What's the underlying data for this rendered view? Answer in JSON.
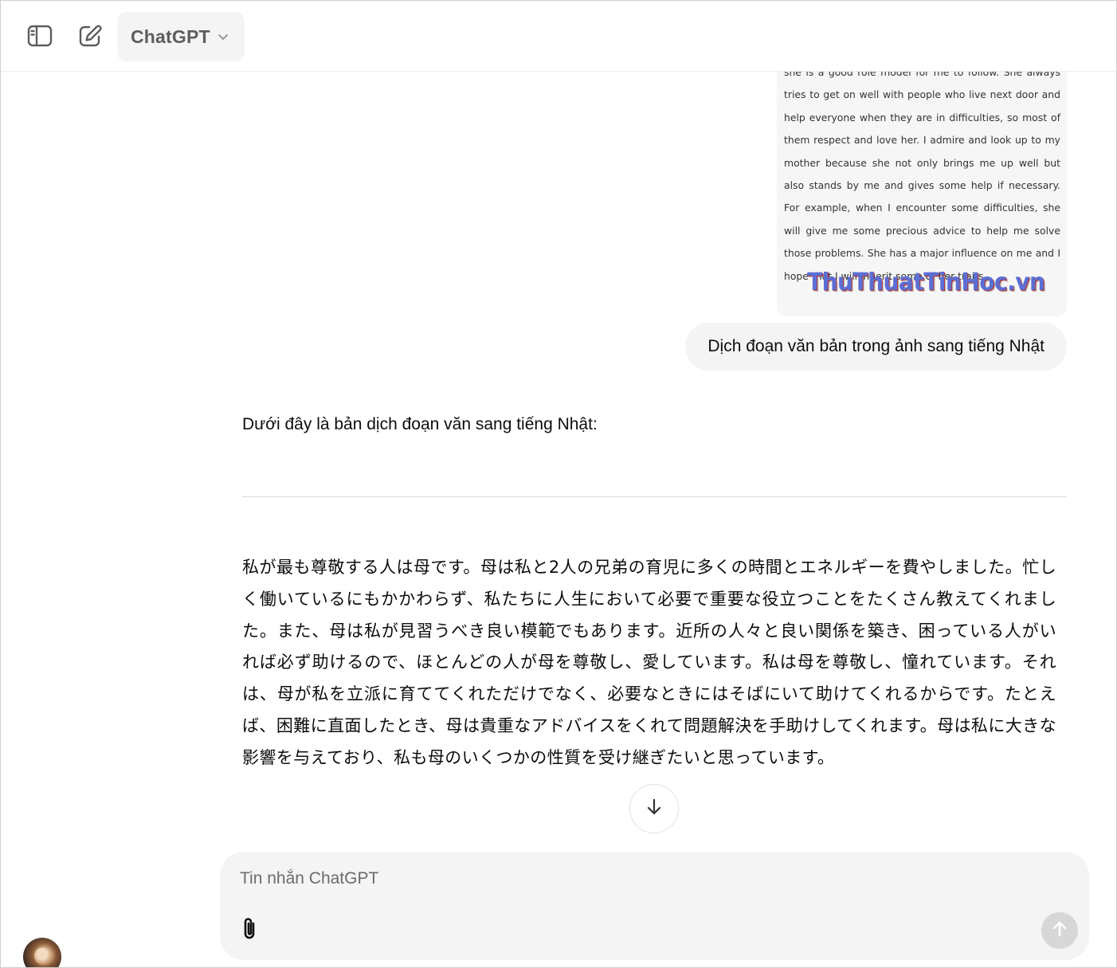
{
  "header": {
    "model_name": "ChatGPT",
    "icons": {
      "sidebar_toggle": "sidebar-toggle-icon",
      "new_chat": "new-chat-icon",
      "model_chevron": "chevron-down-icon"
    }
  },
  "conversation": {
    "attached_image": {
      "text": "she is a good role model for me to follow. She always tries to get on well with people who live next door and help everyone when they are in difficulties, so most of them respect and love her. I admire and look up to my mother because she not only brings me up well but also stands by me and gives some help if necessary. For example, when I encounter some difficulties, she will give me some precious advice to help me solve those problems. She has a major influence on me and I hope that I will inherit some of her traits.",
      "watermark": "ThuThuatTinHoc.vn"
    },
    "user_message": "Dịch đoạn văn bản trong ảnh sang tiếng Nhật",
    "assistant": {
      "intro": "Dưới đây là bản dịch đoạn văn sang tiếng Nhật:",
      "body": "私が最も尊敬する人は母です。母は私と2人の兄弟の育児に多くの時間とエネルギーを費やしました。忙しく働いているにもかかわらず、私たちに人生において必要で重要な役立つことをたくさん教えてくれました。また、母は私が見習うべき良い模範でもあります。近所の人々と良い関係を築き、困っている人がいれば必ず助けるので、ほとんどの人が母を尊敬し、愛しています。私は母を尊敬し、憧れています。それは、母が私を立派に育ててくれただけでなく、必要なときにはそばにいて助けてくれるからです。たとえば、困難に直面したとき、母は貴重なアドバイスをくれて問題解決を手助けしてくれます。母は私に大きな影響を与えており、私も母のいくつかの性質を受け継ぎたいと思っています。"
    }
  },
  "composer": {
    "placeholder": "Tin nhắn ChatGPT",
    "value": "",
    "icons": {
      "attach": "paperclip-icon",
      "send": "arrow-up-icon",
      "scroll_down": "arrow-down-icon"
    }
  },
  "colors": {
    "bubble_bg": "#f4f4f4",
    "send_disabled": "#d7d7d7",
    "text": "#0d0d0d",
    "watermark": "#5b6fd6"
  }
}
